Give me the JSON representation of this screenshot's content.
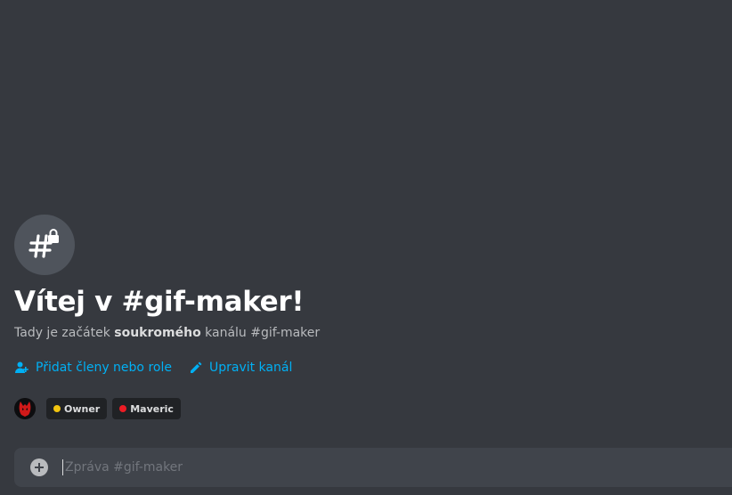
{
  "channel": {
    "name": "#gif-maker",
    "icon": "private-channel-hash-lock-icon"
  },
  "welcome": {
    "title": "Vítej v #gif-maker!",
    "desc_prefix": "Tady je začátek ",
    "desc_bold": "soukromého",
    "desc_suffix": " kanálu #gif-maker"
  },
  "actions": {
    "add_members_label": "Přidat členy nebo role",
    "edit_channel_label": "Upravit kanál"
  },
  "roles": {
    "avatar_icon": "spider-mask-avatar",
    "items": [
      {
        "name": "Owner",
        "color": "#f1c40f"
      },
      {
        "name": "Maveric",
        "color": "#ed1c24"
      }
    ]
  },
  "composer": {
    "placeholder": "Zpráva #gif-maker",
    "value": ""
  },
  "colors": {
    "background": "#36393f",
    "link": "#00b0f4",
    "input_bg": "#40444b"
  }
}
